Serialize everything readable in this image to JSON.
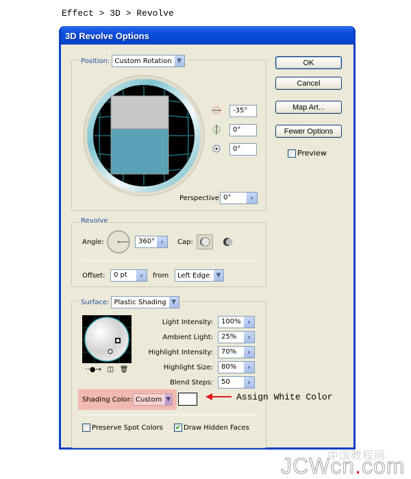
{
  "menu_path": "Effect > 3D > Revolve",
  "dialog": {
    "title": "3D Revolve Options",
    "position": {
      "label": "Position:",
      "preset": "Custom Rotation",
      "rotation_x": "-35°",
      "rotation_y": "0°",
      "rotation_z": "0°",
      "perspective_label": "Perspective:",
      "perspective": "0°",
      "icons": [
        "x-axis-rotate-icon",
        "y-axis-rotate-icon",
        "z-axis-rotate-icon"
      ]
    },
    "revolve": {
      "label": "Revolve",
      "angle_label": "Angle:",
      "angle": "360°",
      "cap_label": "Cap:",
      "offset_label": "Offset:",
      "offset": "0 pt",
      "from_label": "from",
      "from_value": "Left Edge"
    },
    "surface": {
      "label": "Surface:",
      "value": "Plastic Shading",
      "light_intensity_label": "Light Intensity:",
      "light_intensity": "100%",
      "ambient_light_label": "Ambient Light:",
      "ambient_light": "25%",
      "highlight_intensity_label": "Highlight Intensity:",
      "highlight_intensity": "70%",
      "highlight_size_label": "Highlight Size:",
      "highlight_size": "80%",
      "blend_steps_label": "Blend Steps:",
      "blend_steps": "50",
      "shading_color_label": "Shading Color:",
      "shading_color": "Custom",
      "shading_swatch_color": "#ffffff",
      "preserve_spot_colors_label": "Preserve Spot Colors",
      "preserve_spot_colors": false,
      "draw_hidden_faces_label": "Draw Hidden Faces",
      "draw_hidden_faces": true
    },
    "buttons": {
      "ok": "OK",
      "cancel": "Cancel",
      "map_art": "Map Art...",
      "fewer_options": "Fewer Options",
      "preview_label": "Preview",
      "preview": false
    }
  },
  "annotation": {
    "text": "Assign White Color",
    "arrow_color": "#e0181c",
    "highlight_color": "#f2b9b0"
  },
  "watermark": {
    "cn": "中国教程网",
    "text_a": "JCWcn",
    "dot": ".",
    "text_b": "com"
  }
}
